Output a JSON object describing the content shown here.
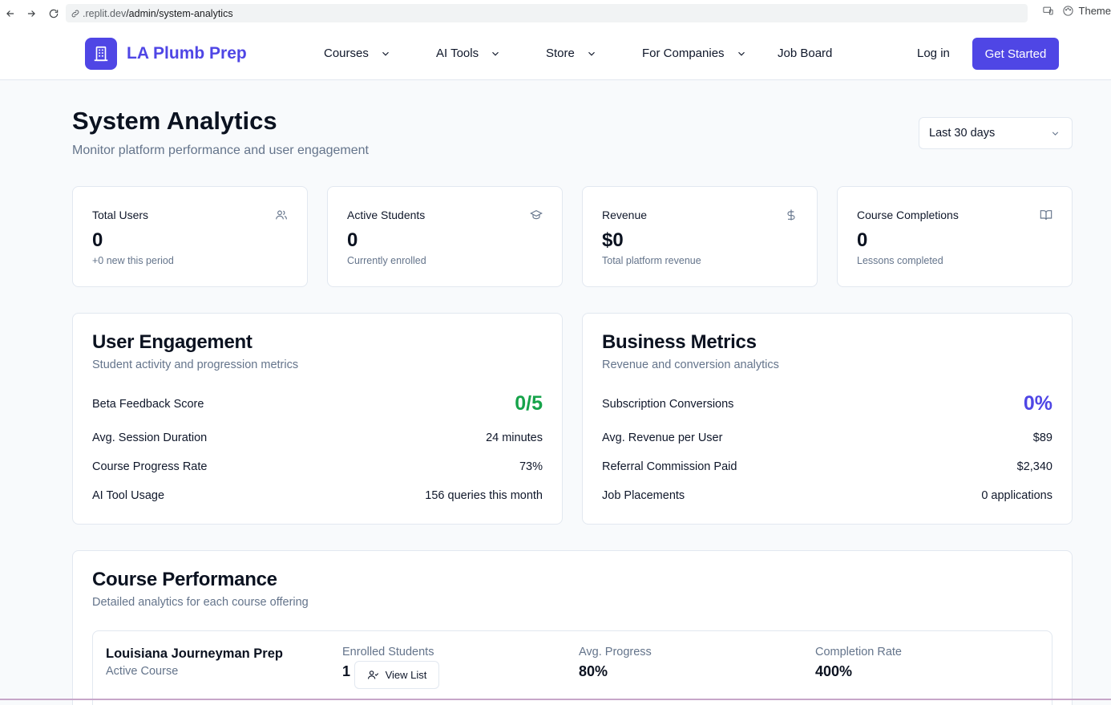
{
  "browser": {
    "url_host": ".replit.dev",
    "url_path": "/admin/system-analytics",
    "theme_label": "Theme"
  },
  "header": {
    "brand": "LA Plumb Prep",
    "nav": [
      {
        "label": "Courses",
        "dropdown": true
      },
      {
        "label": "AI Tools",
        "dropdown": true
      },
      {
        "label": "Store",
        "dropdown": true
      },
      {
        "label": "For Companies",
        "dropdown": true
      },
      {
        "label": "Job Board",
        "dropdown": false
      }
    ],
    "login": "Log in",
    "cta": "Get Started"
  },
  "page": {
    "title": "System Analytics",
    "subtitle": "Monitor platform performance and user engagement",
    "period": "Last 30 days"
  },
  "stats": [
    {
      "label": "Total Users",
      "value": "0",
      "note": "+0 new this period",
      "icon": "users-icon"
    },
    {
      "label": "Active Students",
      "value": "0",
      "note": "Currently enrolled",
      "icon": "graduation-cap-icon"
    },
    {
      "label": "Revenue",
      "value": "$0",
      "note": "Total platform revenue",
      "icon": "dollar-icon"
    },
    {
      "label": "Course Completions",
      "value": "0",
      "note": "Lessons completed",
      "icon": "book-open-icon"
    }
  ],
  "engagement": {
    "title": "User Engagement",
    "subtitle": "Student activity and progression metrics",
    "rows": [
      {
        "label": "Beta Feedback Score",
        "value": "0/5"
      },
      {
        "label": "Avg. Session Duration",
        "value": "24 minutes"
      },
      {
        "label": "Course Progress Rate",
        "value": "73%"
      },
      {
        "label": "AI Tool Usage",
        "value": "156 queries this month"
      }
    ],
    "accent": "#16a34a"
  },
  "business": {
    "title": "Business Metrics",
    "subtitle": "Revenue and conversion analytics",
    "rows": [
      {
        "label": "Subscription Conversions",
        "value": "0%"
      },
      {
        "label": "Avg. Revenue per User",
        "value": "$89"
      },
      {
        "label": "Referral Commission Paid",
        "value": "$2,340"
      },
      {
        "label": "Job Placements",
        "value": "0 applications"
      }
    ],
    "accent": "#4f46e5"
  },
  "courses": {
    "title": "Course Performance",
    "subtitle": "Detailed analytics for each course offering",
    "columns": [
      "Enrolled Students",
      "Avg. Progress",
      "Completion Rate"
    ],
    "items": [
      {
        "name": "Louisiana Journeyman Prep",
        "status": "Active Course",
        "enrolled": "1",
        "view_list": "View List",
        "avg_progress": "80%",
        "completion_rate": "400%"
      }
    ]
  },
  "colors": {
    "brand": "#4f46e5",
    "positive": "#16a34a"
  }
}
